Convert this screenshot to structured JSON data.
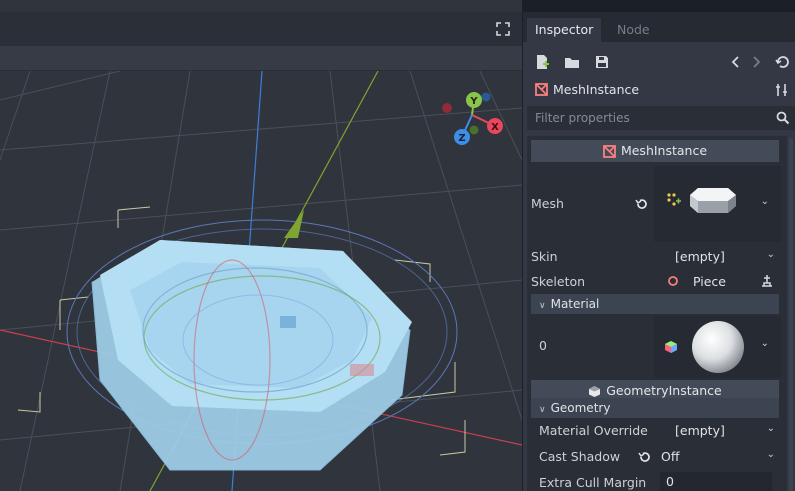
{
  "inspector": {
    "tabs": [
      {
        "label": "Inspector",
        "active": true
      },
      {
        "label": "Node",
        "active": false
      }
    ],
    "toolbar_icons": [
      "new-resource-icon",
      "open-folder-icon",
      "save-icon",
      "history-back-icon",
      "history-forward-icon",
      "object-history-icon"
    ],
    "node": {
      "name": "MeshInstance",
      "icon": "mesh-instance-icon",
      "tools_icon": "node-tools-icon"
    },
    "filter": {
      "placeholder": "Filter properties",
      "icon": "search-icon"
    },
    "sections": {
      "mesh_instance": {
        "title": "MeshInstance",
        "icon": "mesh-instance-icon"
      },
      "geometry_instance": {
        "title": "GeometryInstance",
        "icon": "geometry-instance-icon"
      }
    },
    "properties": {
      "mesh": {
        "label": "Mesh",
        "preview": "octagon-mesh-preview"
      },
      "skin": {
        "label": "Skin",
        "value": "[empty]"
      },
      "skeleton": {
        "label": "Skeleton",
        "value": "Piece"
      },
      "material_group": {
        "label": "Material"
      },
      "material_0": {
        "label": "0",
        "preview": "sphere-material-preview"
      },
      "geometry_group": {
        "label": "Geometry"
      },
      "material_override": {
        "label": "Material Override",
        "value": "[empty]"
      },
      "cast_shadow": {
        "label": "Cast Shadow",
        "value": "Off"
      },
      "extra_cull_margin": {
        "label": "Extra Cull Margin",
        "value": "0"
      }
    }
  },
  "viewport": {
    "gizmo_axes": [
      {
        "label": "Y",
        "color": "#8bc44a"
      },
      {
        "label": "X",
        "color": "#e8475c"
      },
      {
        "label": "Z",
        "color": "#3f8ee6"
      }
    ]
  },
  "colors": {
    "accent_red": "#e8475c",
    "mesh_fill": "#a9d9f2",
    "panel_bg": "#333844"
  }
}
